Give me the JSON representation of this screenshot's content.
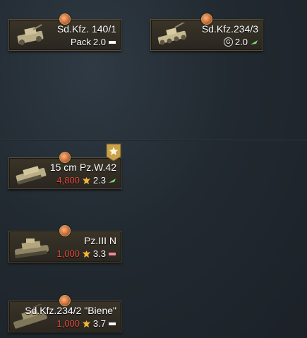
{
  "vehicles": [
    {
      "name": "Sd.Kfz. 140/1",
      "line_label": "Pack",
      "br": "2.0",
      "cost": "",
      "type_icon": "flag-white-icon",
      "currency_icon": ""
    },
    {
      "name": "Sd.Kfz.234/3",
      "line_label": "",
      "br": "2.0",
      "cost": "",
      "type_icon": "leaf-green-icon",
      "currency_icon": "gaijin-coin-icon"
    },
    {
      "name": "15 cm Pz.W.42",
      "line_label": "",
      "br": "2.3",
      "cost": "4,800",
      "type_icon": "leaf-green-icon",
      "currency_icon": "research-eagle-icon"
    },
    {
      "name": "Pz.III N",
      "line_label": "",
      "br": "3.3",
      "cost": "1,000",
      "type_icon": "flag-pink-icon",
      "currency_icon": "research-eagle-icon"
    },
    {
      "name": "Sd.Kfz.234/2 \"Biene\"",
      "line_label": "",
      "br": "3.7",
      "cost": "1,000",
      "type_icon": "flag-white-icon",
      "currency_icon": "research-eagle-icon"
    }
  ],
  "colors": {
    "card_border": "#5a4e37",
    "cost_red": "#e04a3a",
    "leaf_green": "#7fd36b",
    "flag_pink": "#f08a9a",
    "rank_gold": "#c9a14a"
  },
  "rank_badge_icon": "rank-star-icon"
}
